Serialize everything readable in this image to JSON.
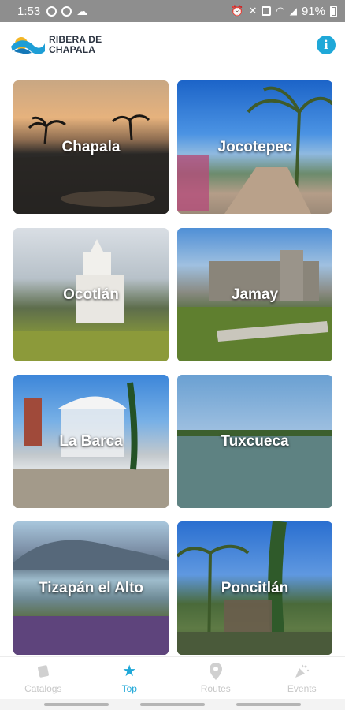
{
  "status_bar": {
    "time": "1:53",
    "battery": "91%",
    "left_icons": [
      "whatsapp-icon",
      "do-not-disturb-icon",
      "cloud-icon"
    ],
    "right_icons": [
      "alarm-icon",
      "mute-icon",
      "vibrate-icon",
      "wifi-icon",
      "signal-icon",
      "battery-icon"
    ]
  },
  "header": {
    "logo_line1": "RIBERA DE",
    "logo_line2": "CHAPALA",
    "info_icon": "i"
  },
  "cards": [
    {
      "title": "Chapala"
    },
    {
      "title": "Jocotepec"
    },
    {
      "title": "Ocotlán"
    },
    {
      "title": "Jamay"
    },
    {
      "title": "La Barca"
    },
    {
      "title": "Tuxcueca"
    },
    {
      "title": "Tizapán el Alto"
    },
    {
      "title": "Poncitlán"
    }
  ],
  "nav": {
    "items": [
      {
        "label": "Catalogs",
        "icon": "catalog-icon"
      },
      {
        "label": "Top",
        "icon": "star-icon"
      },
      {
        "label": "Routes",
        "icon": "map-pin-icon"
      },
      {
        "label": "Events",
        "icon": "party-popper-icon"
      }
    ],
    "active": "Top",
    "accent_color": "#1fa8d8",
    "inactive_color": "#c8c8c8"
  }
}
